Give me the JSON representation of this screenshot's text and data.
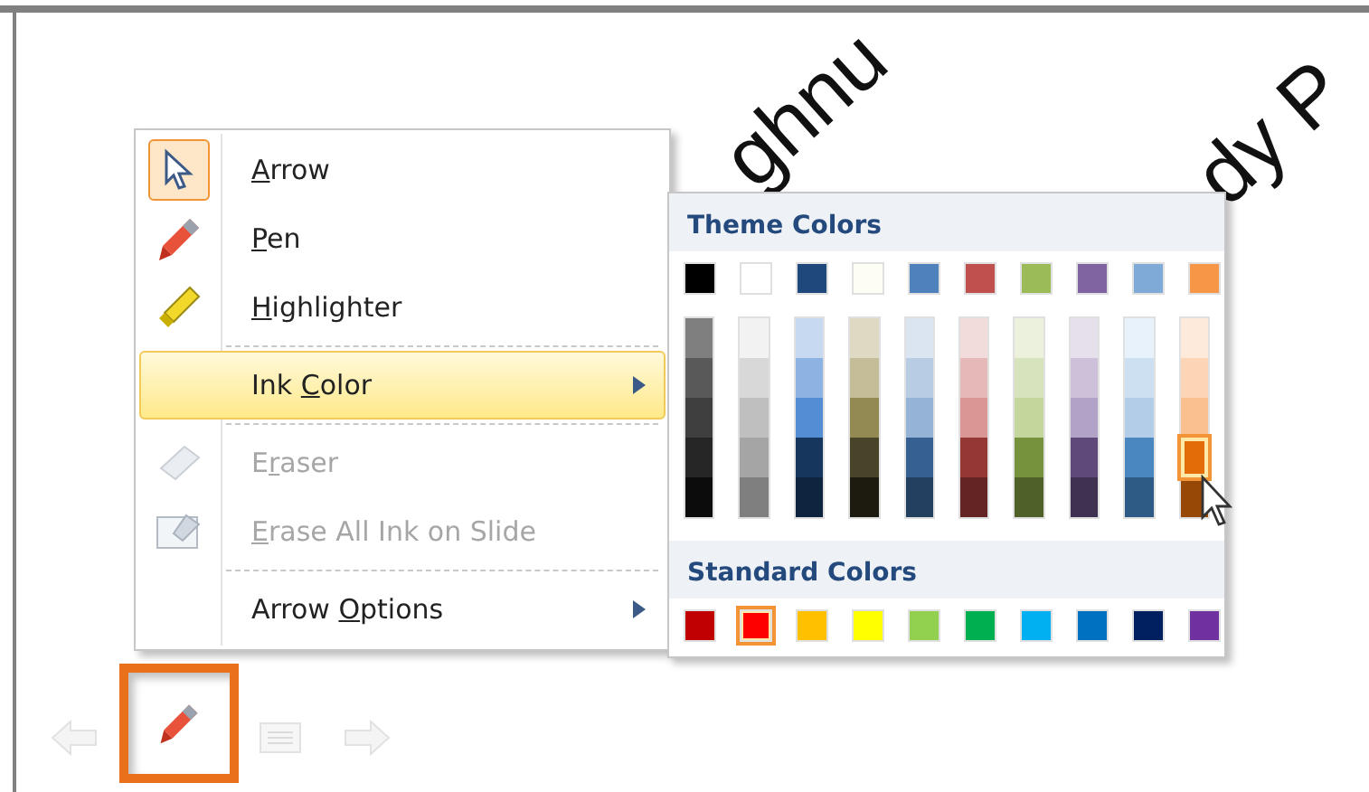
{
  "slide": {
    "texts": [
      {
        "kind": "left",
        "text": "ghnu"
      },
      {
        "kind": "right",
        "text": "dy P"
      }
    ]
  },
  "context_menu": {
    "items": [
      {
        "kind": "arrow",
        "key": "A",
        "after": "rrow",
        "icon_selected": true,
        "disabled": false,
        "hovered": false,
        "submenu": false
      },
      {
        "kind": "pen",
        "key": "P",
        "after": "en",
        "icon_selected": false,
        "disabled": false,
        "hovered": false,
        "submenu": false
      },
      {
        "kind": "highlighter",
        "key": "H",
        "after": "ighlighter",
        "icon_selected": false,
        "disabled": false,
        "hovered": false,
        "submenu": false,
        "separator_after": true
      },
      {
        "kind": "none",
        "before": "Ink ",
        "key": "C",
        "after": "olor",
        "icon_selected": false,
        "disabled": false,
        "hovered": true,
        "submenu": true,
        "separator_after": true
      },
      {
        "kind": "eraser",
        "before": "E",
        "key": "r",
        "after": "aser",
        "icon_selected": false,
        "disabled": true,
        "hovered": false,
        "submenu": false
      },
      {
        "kind": "erase-all",
        "key": "E",
        "after": "rase All Ink on Slide",
        "icon_selected": false,
        "disabled": true,
        "hovered": false,
        "submenu": false,
        "separator_after": true
      },
      {
        "kind": "none",
        "before": "Arrow ",
        "key": "O",
        "after": "ptions",
        "icon_selected": false,
        "disabled": false,
        "hovered": false,
        "submenu": true
      }
    ]
  },
  "ink_color_palette": {
    "theme_title": "Theme Colors",
    "theme_colors": [
      {
        "color": "#000000",
        "selected": false
      },
      {
        "color": "#ffffff",
        "selected": false
      },
      {
        "color": "#1f497d",
        "selected": false
      },
      {
        "color": "#fdfdf3",
        "selected": false
      },
      {
        "color": "#4f81bd",
        "selected": false
      },
      {
        "color": "#c0504d",
        "selected": false
      },
      {
        "color": "#9bbb59",
        "selected": false
      },
      {
        "color": "#8064a2",
        "selected": false
      },
      {
        "color": "#7faad8",
        "selected": false
      },
      {
        "color": "#f79646",
        "selected": false
      }
    ],
    "shades": [
      [
        {
          "color": "#7f7f7f",
          "selected": false
        },
        {
          "color": "#595959",
          "selected": false
        },
        {
          "color": "#3f3f3f",
          "selected": false
        },
        {
          "color": "#262626",
          "selected": false
        },
        {
          "color": "#0c0c0c",
          "selected": false
        }
      ],
      [
        {
          "color": "#f2f2f2",
          "selected": false
        },
        {
          "color": "#d8d8d8",
          "selected": false
        },
        {
          "color": "#bfbfbf",
          "selected": false
        },
        {
          "color": "#a5a5a5",
          "selected": false
        },
        {
          "color": "#7f7f7f",
          "selected": false
        }
      ],
      [
        {
          "color": "#c6d9f0",
          "selected": false
        },
        {
          "color": "#8db3e2",
          "selected": false
        },
        {
          "color": "#548dd4",
          "selected": false
        },
        {
          "color": "#17365d",
          "selected": false
        },
        {
          "color": "#0f243e",
          "selected": false
        }
      ],
      [
        {
          "color": "#ddd9c3",
          "selected": false
        },
        {
          "color": "#c4bd97",
          "selected": false
        },
        {
          "color": "#938953",
          "selected": false
        },
        {
          "color": "#494429",
          "selected": false
        },
        {
          "color": "#1d1b10",
          "selected": false
        }
      ],
      [
        {
          "color": "#dbe5f1",
          "selected": false
        },
        {
          "color": "#b8cce4",
          "selected": false
        },
        {
          "color": "#95b3d7",
          "selected": false
        },
        {
          "color": "#366092",
          "selected": false
        },
        {
          "color": "#244061",
          "selected": false
        }
      ],
      [
        {
          "color": "#f2dcdb",
          "selected": false
        },
        {
          "color": "#e5b9b7",
          "selected": false
        },
        {
          "color": "#d99694",
          "selected": false
        },
        {
          "color": "#953734",
          "selected": false
        },
        {
          "color": "#632423",
          "selected": false
        }
      ],
      [
        {
          "color": "#ebf1dd",
          "selected": false
        },
        {
          "color": "#d7e3bc",
          "selected": false
        },
        {
          "color": "#c3d69b",
          "selected": false
        },
        {
          "color": "#76923c",
          "selected": false
        },
        {
          "color": "#4f6128",
          "selected": false
        }
      ],
      [
        {
          "color": "#e5e0ec",
          "selected": false
        },
        {
          "color": "#ccc1d9",
          "selected": false
        },
        {
          "color": "#b2a2c7",
          "selected": false
        },
        {
          "color": "#5f497a",
          "selected": false
        },
        {
          "color": "#3f3151",
          "selected": false
        }
      ],
      [
        {
          "color": "#e8f2fb",
          "selected": false
        },
        {
          "color": "#cde0f2",
          "selected": false
        },
        {
          "color": "#b3cde8",
          "selected": false
        },
        {
          "color": "#4a86c0",
          "selected": false
        },
        {
          "color": "#2e5b85",
          "selected": false
        }
      ],
      [
        {
          "color": "#fdeada",
          "selected": false
        },
        {
          "color": "#fbd5b5",
          "selected": false
        },
        {
          "color": "#fac08f",
          "selected": false
        },
        {
          "color": "#e36c09",
          "selected": true
        },
        {
          "color": "#974806",
          "selected": false
        }
      ]
    ],
    "standard_title": "Standard Colors",
    "standard_colors": [
      {
        "color": "#c00000",
        "selected": false
      },
      {
        "color": "#ff0000",
        "selected": true
      },
      {
        "color": "#ffc000",
        "selected": false
      },
      {
        "color": "#ffff00",
        "selected": false
      },
      {
        "color": "#92d050",
        "selected": false
      },
      {
        "color": "#00b050",
        "selected": false
      },
      {
        "color": "#00b0f0",
        "selected": false
      },
      {
        "color": "#0070c0",
        "selected": false
      },
      {
        "color": "#002060",
        "selected": false
      },
      {
        "color": "#7030a0",
        "selected": false
      }
    ]
  },
  "slideshow_toolbar": {
    "buttons": [
      {
        "kind": "previous",
        "highlighted": false
      },
      {
        "kind": "pen",
        "highlighted": true
      },
      {
        "kind": "menu",
        "highlighted": false
      },
      {
        "kind": "next",
        "highlighted": false
      }
    ]
  }
}
